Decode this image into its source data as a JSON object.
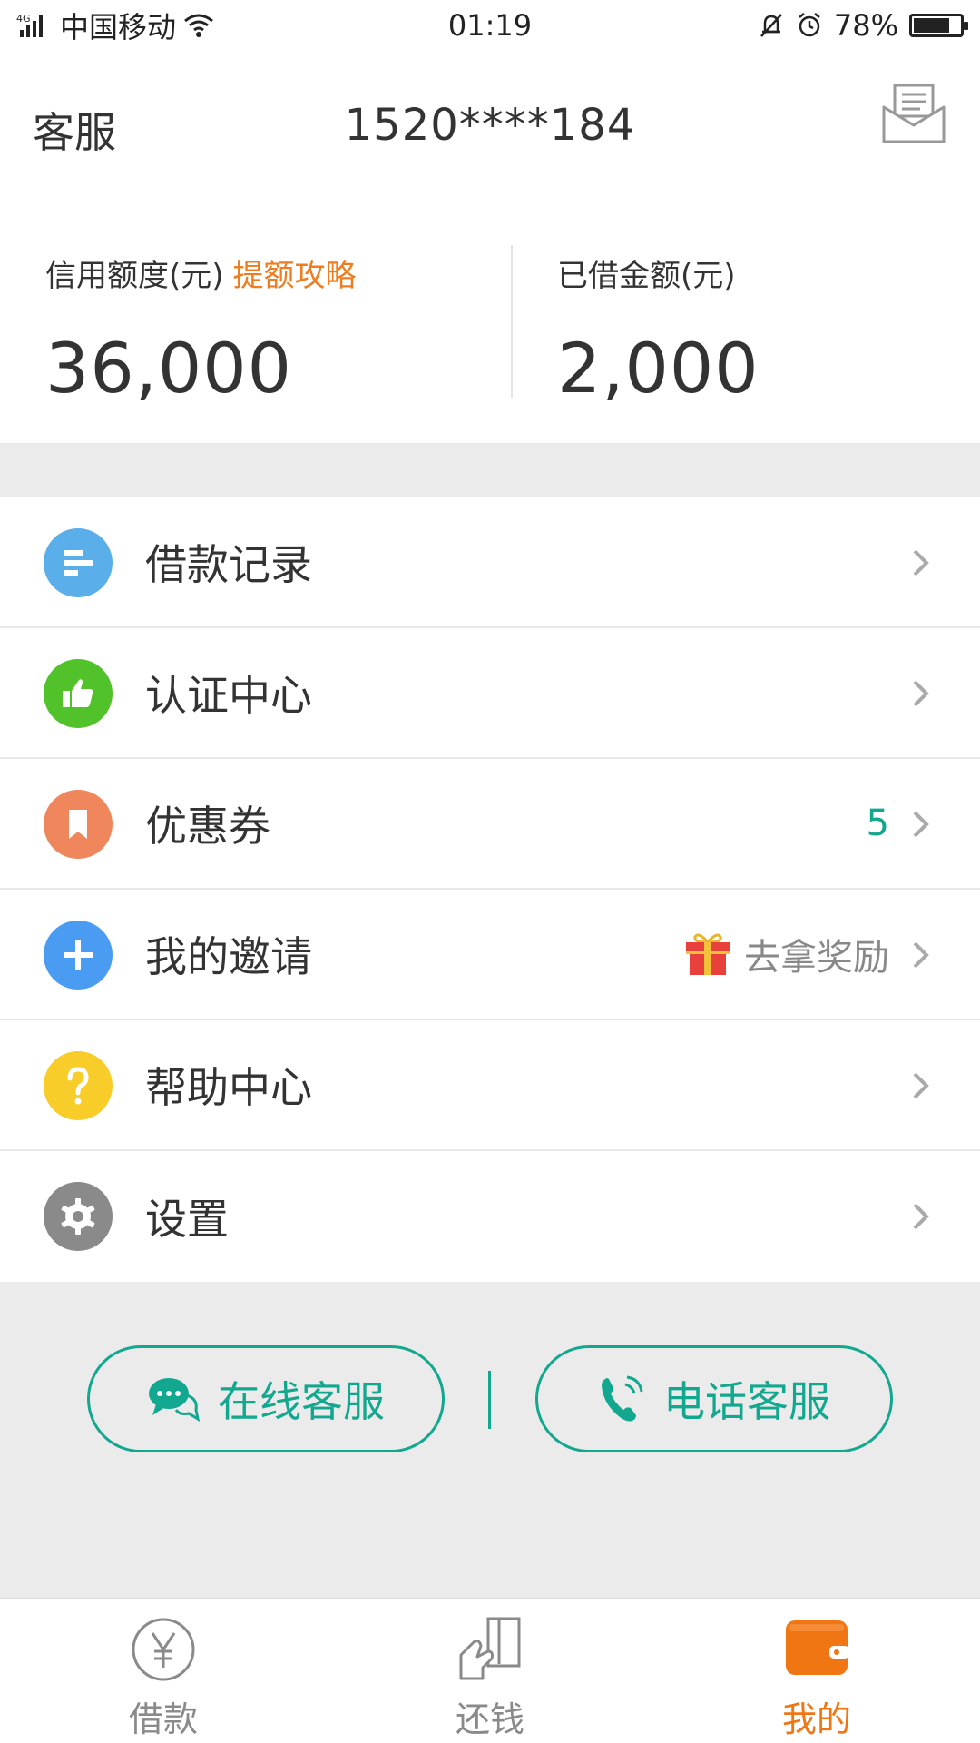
{
  "status_bar": {
    "network": "4G",
    "carrier": "中国移动",
    "time": "01:19",
    "battery_percent": "78%",
    "battery_level": 0.78
  },
  "header": {
    "customer_service": "客服",
    "phone": "1520****184",
    "mail_icon": "mail-icon"
  },
  "credit": {
    "limit_label": "信用额度(元)",
    "limit_link": "提额攻略",
    "limit_value": "36,000",
    "borrowed_label": "已借金额(元)",
    "borrowed_value": "2,000"
  },
  "menu": {
    "items": [
      {
        "label": "借款记录",
        "icon": "list-icon",
        "color": "#5aaeea"
      },
      {
        "label": "认证中心",
        "icon": "thumbs-up-icon",
        "color": "#52c22b"
      },
      {
        "label": "优惠券",
        "icon": "bookmark-icon",
        "color": "#f0875c",
        "badge": "5"
      },
      {
        "label": "我的邀请",
        "icon": "plus-icon",
        "color": "#4a9cf2",
        "extra": "去拿奖励"
      },
      {
        "label": "帮助中心",
        "icon": "question-icon",
        "color": "#f8cd2a"
      },
      {
        "label": "设置",
        "icon": "gear-icon",
        "color": "#8a8a8a"
      }
    ]
  },
  "service": {
    "online_label": "在线客服",
    "phone_label": "电话客服"
  },
  "tabbar": {
    "tabs": [
      {
        "label": "借款",
        "icon": "yen-icon"
      },
      {
        "label": "还钱",
        "icon": "repay-icon"
      },
      {
        "label": "我的",
        "icon": "wallet-icon",
        "active": true
      }
    ]
  },
  "colors": {
    "accent_orange": "#f07614",
    "accent_green": "#12a88f"
  }
}
